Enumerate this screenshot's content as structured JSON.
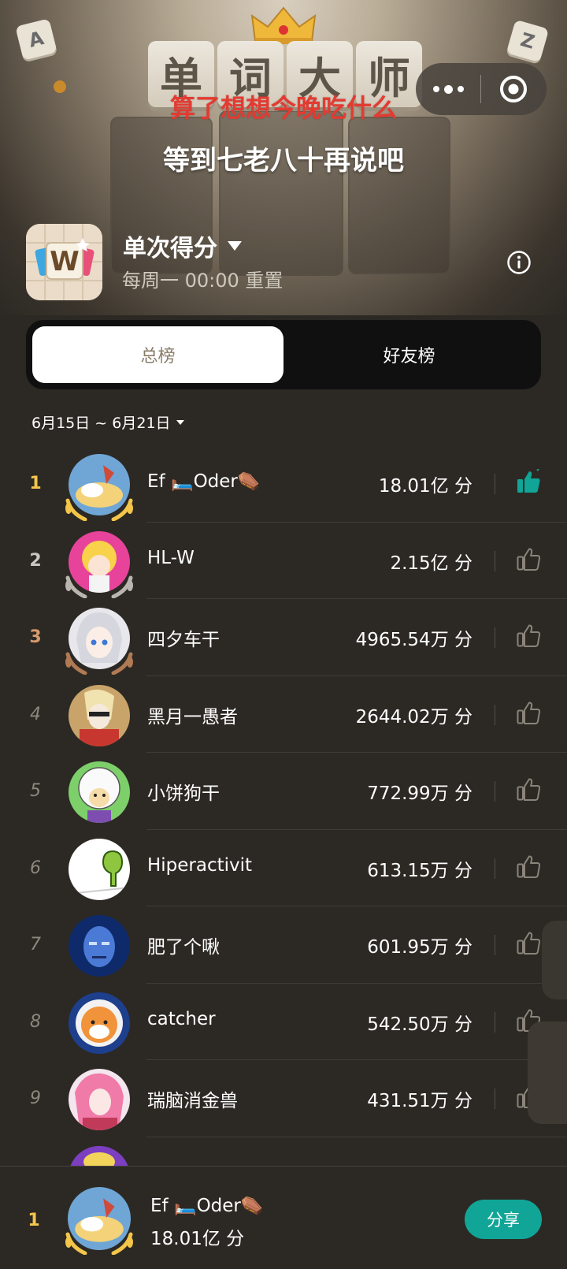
{
  "header": {
    "game_title_chars": [
      "单",
      "词",
      "大",
      "师"
    ],
    "slogan_line1": "算了想想今晚吃什么",
    "slogan_line2": "等到七老八十再说吧",
    "corner_letters": [
      "A",
      "Z"
    ],
    "capsule_icons": [
      "more-icon",
      "target-icon"
    ]
  },
  "game": {
    "icon_letter": "W",
    "mode_title": "单次得分",
    "reset_text": "每周一 00:00 重置"
  },
  "tabs": [
    {
      "label": "总榜",
      "active": true
    },
    {
      "label": "好友榜",
      "active": false
    }
  ],
  "date_range": "6月15日 ~ 6月21日",
  "leaderboard": [
    {
      "rank": "1",
      "name": "Ef 🛏️Oder⚰️",
      "score": "18.01亿 分",
      "liked": true
    },
    {
      "rank": "2",
      "name": "HL-W",
      "score": "2.15亿 分",
      "liked": false
    },
    {
      "rank": "3",
      "name": "四夕车干",
      "score": "4965.54万 分",
      "liked": false
    },
    {
      "rank": "4",
      "name": "黑月一愚者",
      "score": "2644.02万 分",
      "liked": false
    },
    {
      "rank": "5",
      "name": "小饼狗干",
      "score": "772.99万 分",
      "liked": false
    },
    {
      "rank": "6",
      "name": "Hiperactivit",
      "score": "613.15万 分",
      "liked": false
    },
    {
      "rank": "7",
      "name": "肥了个啾",
      "score": "601.95万 分",
      "liked": false
    },
    {
      "rank": "8",
      "name": "catcher",
      "score": "542.50万 分",
      "liked": false
    },
    {
      "rank": "9",
      "name": "瑞脑消金兽",
      "score": "431.51万 分",
      "liked": false
    }
  ],
  "me": {
    "rank": "1",
    "name": "Ef 🛏️Oder⚰️",
    "score": "18.01亿 分",
    "share_label": "分享"
  },
  "colors": {
    "background": "#2c2924",
    "gold": "#f3c64a",
    "silver": "#c9c7c2",
    "bronze": "#d79a6d",
    "accent_teal": "#10a596",
    "slogan_red": "#e23b32"
  }
}
